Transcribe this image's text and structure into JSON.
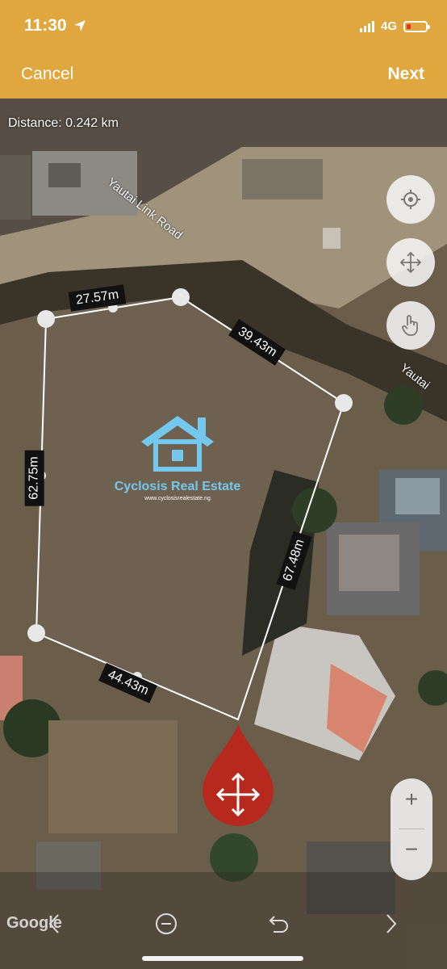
{
  "status": {
    "time": "11:30",
    "network": "4G"
  },
  "nav": {
    "cancel": "Cancel",
    "next": "Next"
  },
  "map": {
    "distance": "Distance: 0.242 km",
    "road_label": "Yautai Link Road",
    "road_label_2": "Yautai",
    "segments": [
      "27.57m",
      "39.43m",
      "67.48m",
      "44.43m",
      "62.75m"
    ],
    "google": "Google"
  },
  "watermark": {
    "name": "Cyclosis Real Estate",
    "url": "www.cyclosisrealestate.ng"
  },
  "zoom": {
    "plus": "+",
    "minus": "−"
  },
  "colors": {
    "header": "#dfa73e",
    "marker": "#c0221b",
    "watermark": "#74c8ee",
    "battery": "#e0342c"
  },
  "icons": [
    "location-arrow-icon",
    "locate-icon",
    "move-icon",
    "hand-pointer-icon",
    "move-arrows-icon",
    "chevron-left-icon",
    "minus-circle-icon",
    "undo-icon",
    "chevron-right-icon"
  ]
}
